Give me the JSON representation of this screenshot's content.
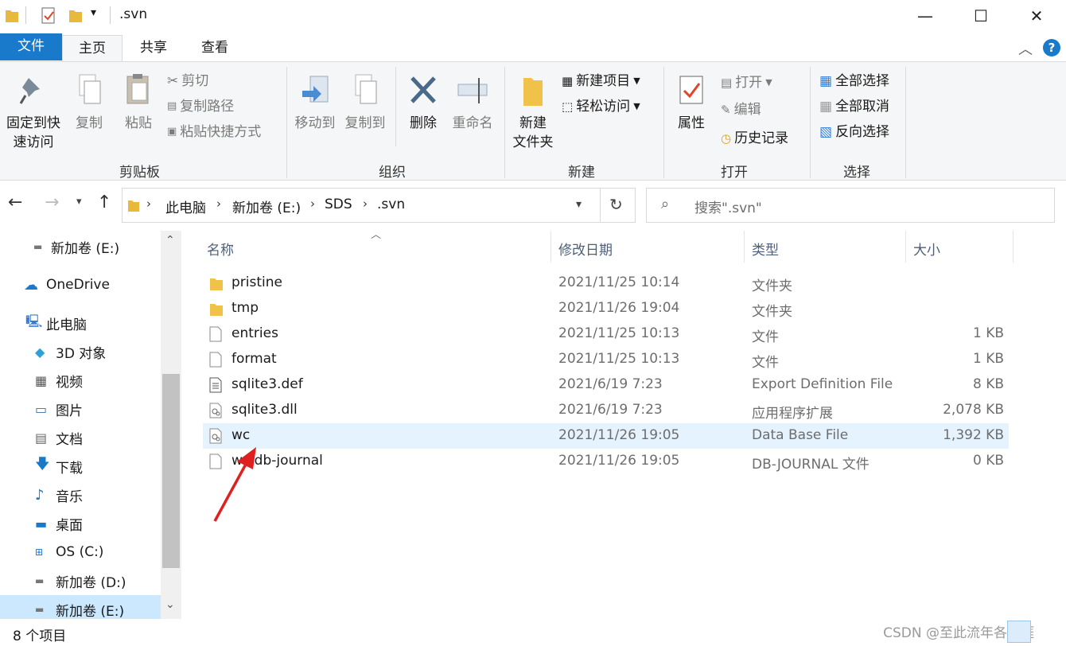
{
  "window": {
    "title": ".svn",
    "minimize_glyph": "—",
    "maximize_glyph": "☐",
    "close_glyph": "✕"
  },
  "ribbon_tabs": [
    {
      "label": "文件"
    },
    {
      "label": "主页"
    },
    {
      "label": "共享"
    },
    {
      "label": "查看"
    }
  ],
  "ribbon": {
    "clipboard": {
      "pin_label_1": "固定到快",
      "pin_label_2": "速访问",
      "copy_label": "复制",
      "paste_label": "粘贴",
      "cut_label": "剪切",
      "copy_path_label": "复制路径",
      "paste_shortcut_label": "粘贴快捷方式",
      "group_label": "剪贴板"
    },
    "organize": {
      "move_to_label": "移动到",
      "copy_to_label": "复制到",
      "delete_label": "删除",
      "rename_label": "重命名",
      "group_label": "组织"
    },
    "new": {
      "new_folder_label_1": "新建",
      "new_folder_label_2": "文件夹",
      "new_item_label": "新建项目",
      "easy_access_label": "轻松访问",
      "group_label": "新建"
    },
    "open": {
      "properties_label": "属性",
      "open_label": "打开",
      "edit_label": "编辑",
      "history_label": "历史记录",
      "group_label": "打开"
    },
    "select": {
      "select_all_label": "全部选择",
      "select_none_label": "全部取消",
      "invert_label": "反向选择",
      "group_label": "选择"
    }
  },
  "address": {
    "crumbs": [
      "此电脑",
      "新加卷 (E:)",
      "SDS",
      ".svn"
    ],
    "search_placeholder": "搜索\".svn\""
  },
  "nav": {
    "items": [
      {
        "label": "新加卷 (E:)",
        "icon": "drive-icon"
      },
      {
        "label": "OneDrive",
        "icon": "cloud-icon"
      },
      {
        "label": "此电脑",
        "icon": "computer-icon"
      },
      {
        "label": "3D 对象",
        "icon": "cube-icon"
      },
      {
        "label": "视频",
        "icon": "video-icon"
      },
      {
        "label": "图片",
        "icon": "picture-icon"
      },
      {
        "label": "文档",
        "icon": "document-icon"
      },
      {
        "label": "下载",
        "icon": "download-icon"
      },
      {
        "label": "音乐",
        "icon": "music-icon"
      },
      {
        "label": "桌面",
        "icon": "desktop-icon"
      },
      {
        "label": "OS (C:)",
        "icon": "windows-drive-icon"
      },
      {
        "label": "新加卷 (D:)",
        "icon": "drive-icon"
      },
      {
        "label": "新加卷 (E:)",
        "icon": "drive-icon"
      }
    ]
  },
  "columns": {
    "name": "名称",
    "date": "修改日期",
    "type": "类型",
    "size": "大小"
  },
  "files": [
    {
      "name": "pristine",
      "date": "2021/11/25 10:14",
      "type": "文件夹",
      "size": "",
      "icon": "folder-icon"
    },
    {
      "name": "tmp",
      "date": "2021/11/26 19:04",
      "type": "文件夹",
      "size": "",
      "icon": "folder-icon"
    },
    {
      "name": "entries",
      "date": "2021/11/25 10:13",
      "type": "文件",
      "size": "1 KB",
      "icon": "file-icon"
    },
    {
      "name": "format",
      "date": "2021/11/25 10:13",
      "type": "文件",
      "size": "1 KB",
      "icon": "file-icon"
    },
    {
      "name": "sqlite3.def",
      "date": "2021/6/19 7:23",
      "type": "Export Definition File",
      "size": "8 KB",
      "icon": "text-file-icon"
    },
    {
      "name": "sqlite3.dll",
      "date": "2021/6/19 7:23",
      "type": "应用程序扩展",
      "size": "2,078 KB",
      "icon": "dll-icon"
    },
    {
      "name": "wc",
      "date": "2021/11/26 19:05",
      "type": "Data Base File",
      "size": "1,392 KB",
      "icon": "db-file-icon"
    },
    {
      "name": "wc.db-journal",
      "date": "2021/11/26 19:05",
      "type": "DB-JOURNAL 文件",
      "size": "0 KB",
      "icon": "file-icon"
    }
  ],
  "status": {
    "item_count": "8 个项目",
    "watermark": "CSDN @至此流年各天涯"
  },
  "colors": {
    "accent": "#1979ca",
    "hover_row": "#e5f3ff",
    "annotation_arrow": "#e02020"
  }
}
